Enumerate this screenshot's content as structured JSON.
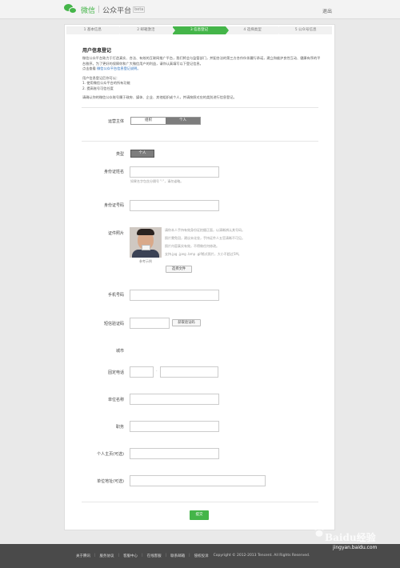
{
  "header": {
    "logo_cn": "微信",
    "logo_sep": "|",
    "logo_sub": "公众平台",
    "logo_beta": "beta",
    "logout": "退出"
  },
  "steps": [
    {
      "label": "1 基本信息",
      "active": false
    },
    {
      "label": "2 邮箱激活",
      "active": false
    },
    {
      "label": "3 信息登记",
      "active": true
    },
    {
      "label": "4 选择类型",
      "active": false
    },
    {
      "label": "5 公众号信息",
      "active": false
    }
  ],
  "intro": {
    "title": "用户信息登记",
    "p1": "微信公众平台致力于打造真实、合法、有效的互联网推广平台，我们将会与监管部门，并配合法的第三方合作伙伴履行承诺，建立和维护良性互动、健康有序的平台秩序。为了更好的保障你和广大微信用户的利益，请你认真填写以下登记信息。",
    "p1_link_prefix": "点击查看",
    "p1_link": "微信公众平台信息登记说明。",
    "p2_title": "用户信息登记后你可以：",
    "p2_item1": "1. 使用微信公众平台的所有功能",
    "p2_item2": "2. 提高账号可信任度",
    "p3": "请确认你的微信公众账号属于政府、媒体、企业、其他组织或个人，并请按照对应的类别进行信息登记。"
  },
  "form": {
    "subject_label": "运营主体",
    "subject_options": [
      "组织",
      "个人"
    ],
    "type_label": "类型",
    "type_value": "个人",
    "id_name_label": "身份证姓名",
    "id_name_hint": "如果名字包含分隔号 \"·\"，请勿省略。",
    "id_number_label": "身份证号码",
    "id_photo_label": "证件照片",
    "photo_caption": "参考示例",
    "photo_hint1": "请你本人手持有效身份证拍摄正面，以清晰辨认其号码。",
    "photo_hint2": "照片需免冠，建议未化妆，手持证件人五官清晰不可见。",
    "photo_hint3": "照片内容真实有效，不得做任何修改。",
    "photo_hint4": "支持.jpg .jpeg .bmp .gif格式照片，大小不超过5M。",
    "choose_file": "选择文件",
    "phone_label": "手机号码",
    "sms_label": "短信验证码",
    "get_code": "获取验证码",
    "city_label": "城市",
    "landline_label": "固定电话",
    "landline_sep": "-",
    "company_label": "单位名称",
    "job_label": "职务",
    "personal_site_label": "个人主页(可选)",
    "company_address_label": "单位地址(可选)",
    "submit": "提交"
  },
  "footer": {
    "links": [
      "关于腾讯",
      "服务协议",
      "客服中心",
      "在线客服",
      "联系邮箱",
      "侵权投诉"
    ],
    "copyright": "Copyright © 2012-2013 Tencent. All Rights Reserved.",
    "watermark": "Baidu经验",
    "watermark_url": "jingyan.baidu.com"
  }
}
